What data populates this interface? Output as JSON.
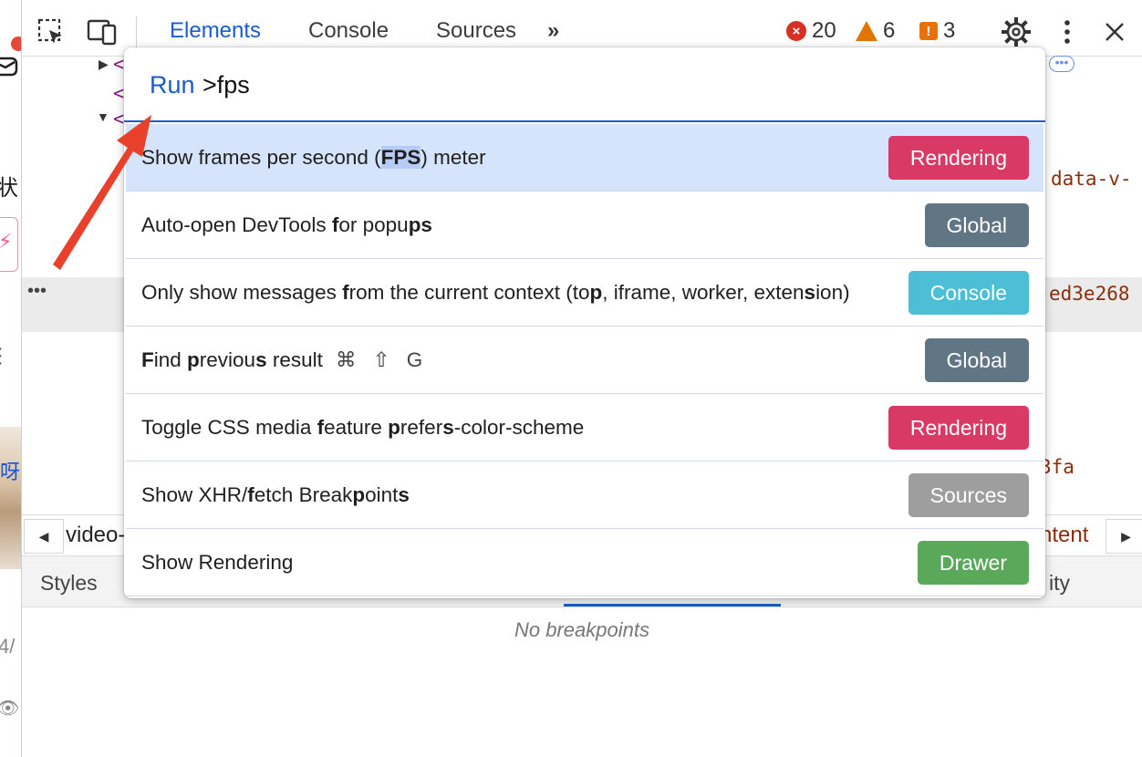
{
  "toolbar": {
    "tabs": [
      {
        "label": "Elements",
        "active": true
      },
      {
        "label": "Console",
        "active": false
      },
      {
        "label": "Sources",
        "active": false
      }
    ],
    "more_tabs_glyph": "»",
    "error_count": "20",
    "warning_count": "6",
    "issue_count": "3",
    "icons": [
      "inspect-element-icon",
      "device-toolbar-icon",
      "more-tabs-icon",
      "gear-icon",
      "kebab-menu-icon",
      "close-icon"
    ]
  },
  "page_strip": {
    "cjk_char": "状",
    "thumb_text": "呀",
    "frac_text": "4/"
  },
  "elements_panel": {
    "frag_attr": "data-v-",
    "frag_hash_1": "ed3e268",
    "frag_hash_2": "3fa",
    "row_dots": "•••",
    "ellipsis_pill": "•••"
  },
  "breadcrumbs": {
    "left_text": "video-",
    "right_text": "ntent"
  },
  "lower_tabs": {
    "left": "Styles",
    "right": "ity",
    "empty_message": "No breakpoints"
  },
  "command_menu": {
    "prefix": "Run",
    "query": ">fps",
    "items": [
      {
        "label": "Show frames per second (FPS) meter",
        "category": "Rendering",
        "color": "#d83965",
        "selected": true
      },
      {
        "label": "Auto-open DevTools for popups",
        "category": "Global",
        "color": "#607684",
        "selected": false
      },
      {
        "label": "Only show messages from the current context (top, iframe, worker, extension)",
        "category": "Console",
        "color": "#4cbed6",
        "selected": false
      },
      {
        "label": "Find previous result",
        "shortcut": "⌘ ⇧ G",
        "category": "Global",
        "color": "#607684",
        "selected": false
      },
      {
        "label": "Toggle CSS media feature prefers-color-scheme",
        "category": "Rendering",
        "color": "#d83965",
        "selected": false
      },
      {
        "label": "Show XHR/fetch Breakpoints",
        "category": "Sources",
        "color": "#9e9e9e",
        "selected": false
      },
      {
        "label": "Show Rendering",
        "category": "Drawer",
        "color": "#5aa85a",
        "selected": false
      }
    ]
  },
  "colors": {
    "accent": "#1a5ccf",
    "annotation_arrow": "#e8402a"
  }
}
